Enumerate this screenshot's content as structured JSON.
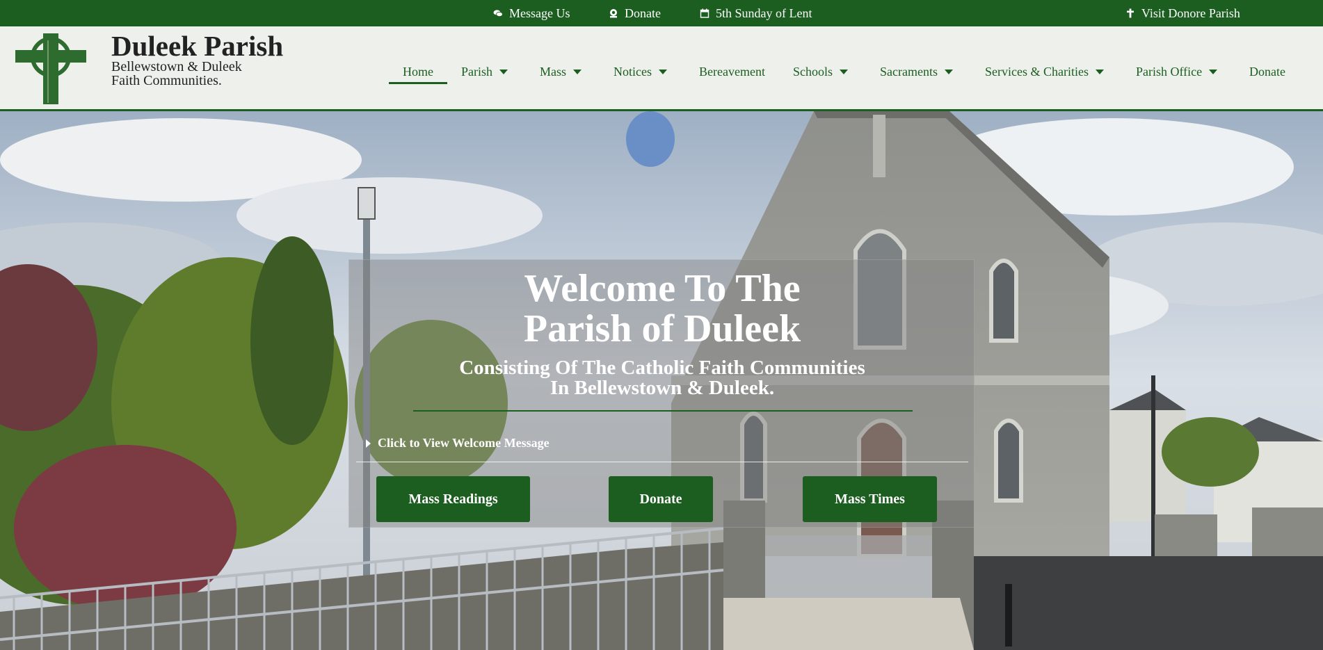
{
  "topbar": {
    "message_us": "Message Us",
    "donate": "Donate",
    "liturgical_day": "5th Sunday of Lent",
    "visit": "Visit Donore Parish",
    "icons": [
      "chat-icon",
      "donate-icon",
      "calendar-icon",
      "cross-icon"
    ]
  },
  "header": {
    "title": "Duleek Parish",
    "subtitle_line1": "Bellewstown & Duleek",
    "subtitle_line2": "Faith Communities."
  },
  "nav": {
    "items": [
      {
        "label": "Home"
      },
      {
        "label": "Parish"
      },
      {
        "label": "Mass"
      },
      {
        "label": "Notices"
      },
      {
        "label": "Bereavement"
      },
      {
        "label": "Schools"
      },
      {
        "label": "Sacraments"
      },
      {
        "label": "Services & Charities"
      },
      {
        "label": "Parish Office"
      },
      {
        "label": "Donate"
      }
    ],
    "active": "Home"
  },
  "hero": {
    "title_line1": "Welcome To The",
    "title_line2": "Parish of Duleek",
    "subtitle_line1": "Consisting Of The Catholic Faith Communities",
    "subtitle_line2": "In Bellewstown & Duleek.",
    "toggle_label": "Click to View Welcome Message",
    "buttons": [
      "Mass Readings",
      "Donate",
      "Mass Times"
    ]
  },
  "colors": {
    "brand_green": "#1b5e20",
    "header_bg": "#eef0ec"
  }
}
